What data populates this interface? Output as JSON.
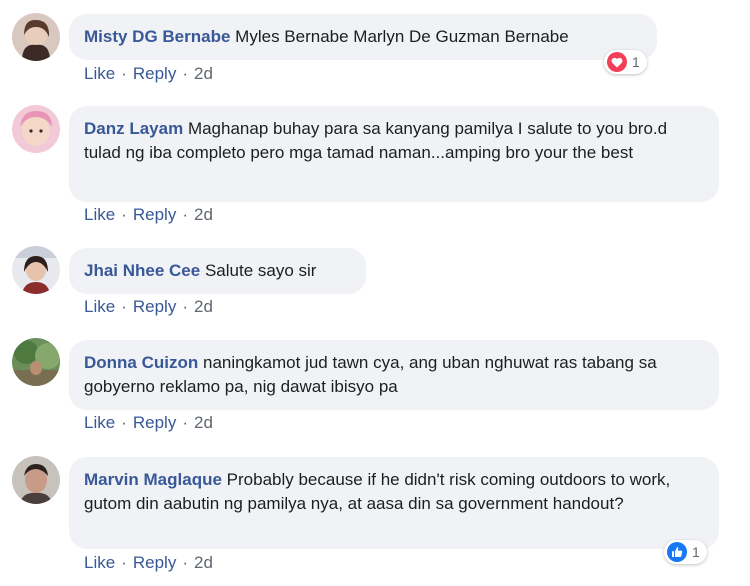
{
  "actions": {
    "like": "Like",
    "reply": "Reply",
    "separator": "·"
  },
  "comments": [
    {
      "author": "Misty DG Bernabe",
      "text": "Myles Bernabe Marlyn De Guzman Bernabe",
      "time": "2d",
      "reaction": {
        "icon": "heart-icon",
        "count": "1",
        "color": "#f33e58"
      }
    },
    {
      "author": "Danz Layam",
      "text": "Maghanap buhay para sa kanyang pamilya I salute to you bro.d tulad ng iba completo pero mga tamad naman...amping bro your the best",
      "time": "2d"
    },
    {
      "author": "Jhai Nhee Cee",
      "text": "Salute sayo sir",
      "time": "2d"
    },
    {
      "author": "Donna Cuizon",
      "text": "naningkamot jud tawn cya, ang uban nghuwat ras tabang sa gobyerno reklamo pa, nig dawat ibisyo pa",
      "time": "2d"
    },
    {
      "author": "Marvin Maglaque",
      "text": "Probably because if he didn't risk coming outdoors to work, gutom din aabutin ng pamilya nya, at aasa din sa government handout?",
      "time": "2d",
      "reaction": {
        "icon": "thumbs-up-icon",
        "count": "1",
        "color": "#1877f2"
      }
    }
  ]
}
